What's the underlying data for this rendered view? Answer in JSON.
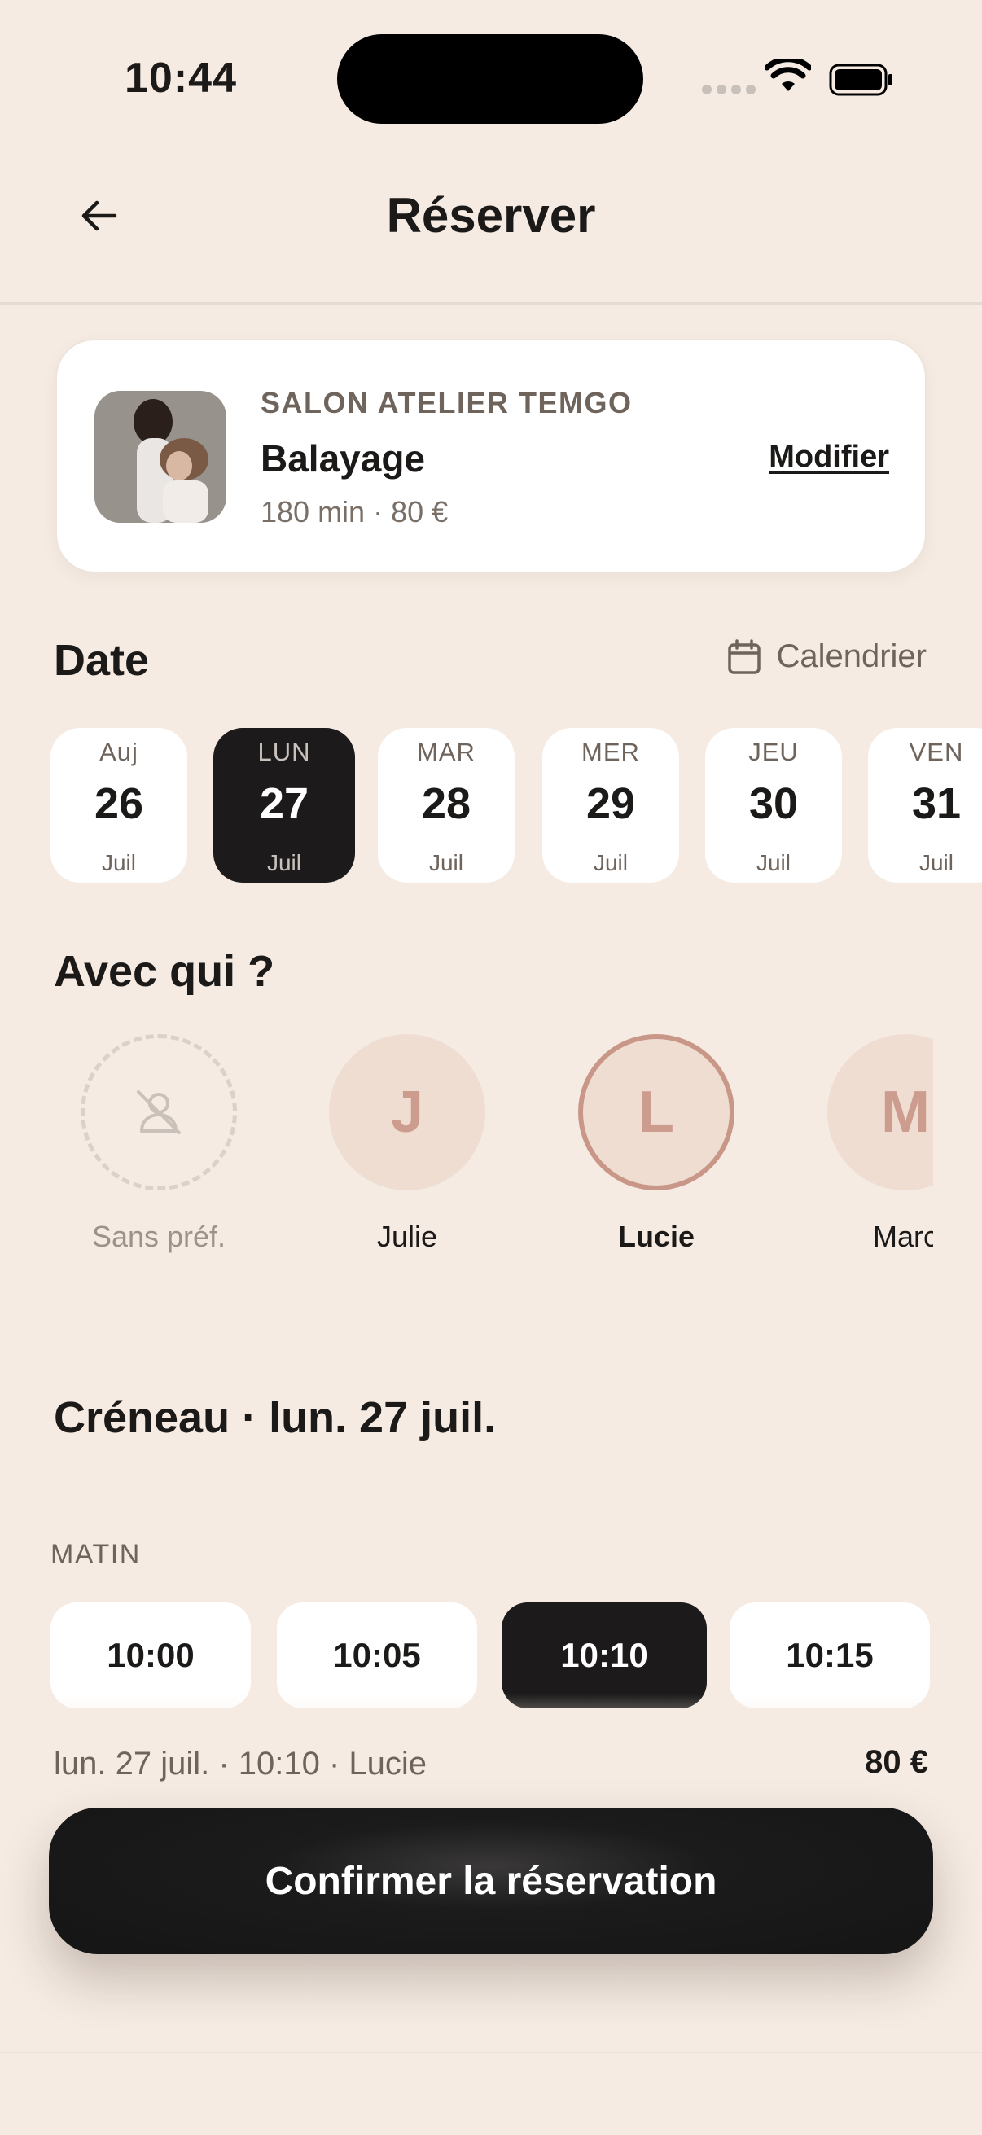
{
  "status_bar": {
    "time": "10:44"
  },
  "header": {
    "title": "Réserver"
  },
  "salon_card": {
    "salon_name": "SALON ATELIER TEMGO",
    "service": "Balayage",
    "meta": "180 min · 80 €",
    "modify_label": "Modifier"
  },
  "date_section": {
    "title": "Date",
    "calendar_label": "Calendrier",
    "days": [
      {
        "dow": "Auj",
        "day": "26",
        "month": "Juil"
      },
      {
        "dow": "LUN",
        "day": "27",
        "month": "Juil"
      },
      {
        "dow": "MAR",
        "day": "28",
        "month": "Juil"
      },
      {
        "dow": "MER",
        "day": "29",
        "month": "Juil"
      },
      {
        "dow": "JEU",
        "day": "30",
        "month": "Juil"
      },
      {
        "dow": "VEN",
        "day": "31",
        "month": "Juil"
      }
    ],
    "selected_index": 1
  },
  "staff_section": {
    "title": "Avec qui ?",
    "members": [
      {
        "initial": "",
        "name": "Sans préf."
      },
      {
        "initial": "J",
        "name": "Julie"
      },
      {
        "initial": "L",
        "name": "Lucie"
      },
      {
        "initial": "M",
        "name": "Marc"
      }
    ],
    "selected": "Lucie"
  },
  "slot_section": {
    "title": "Créneau · lun. 27 juil.",
    "period": "MATIN",
    "slots": [
      "10:00",
      "10:05",
      "10:10",
      "10:15"
    ],
    "selected": "10:10"
  },
  "summary": {
    "text": "lun. 27 juil. · 10:10 · Lucie",
    "price": "80 €",
    "confirm_label": "Confirmer la réservation"
  },
  "colors": {
    "background": "#f5ebe2",
    "dark": "#1c1a1a",
    "accent": "#c99787",
    "avatar_bg": "#f0ddd1"
  }
}
